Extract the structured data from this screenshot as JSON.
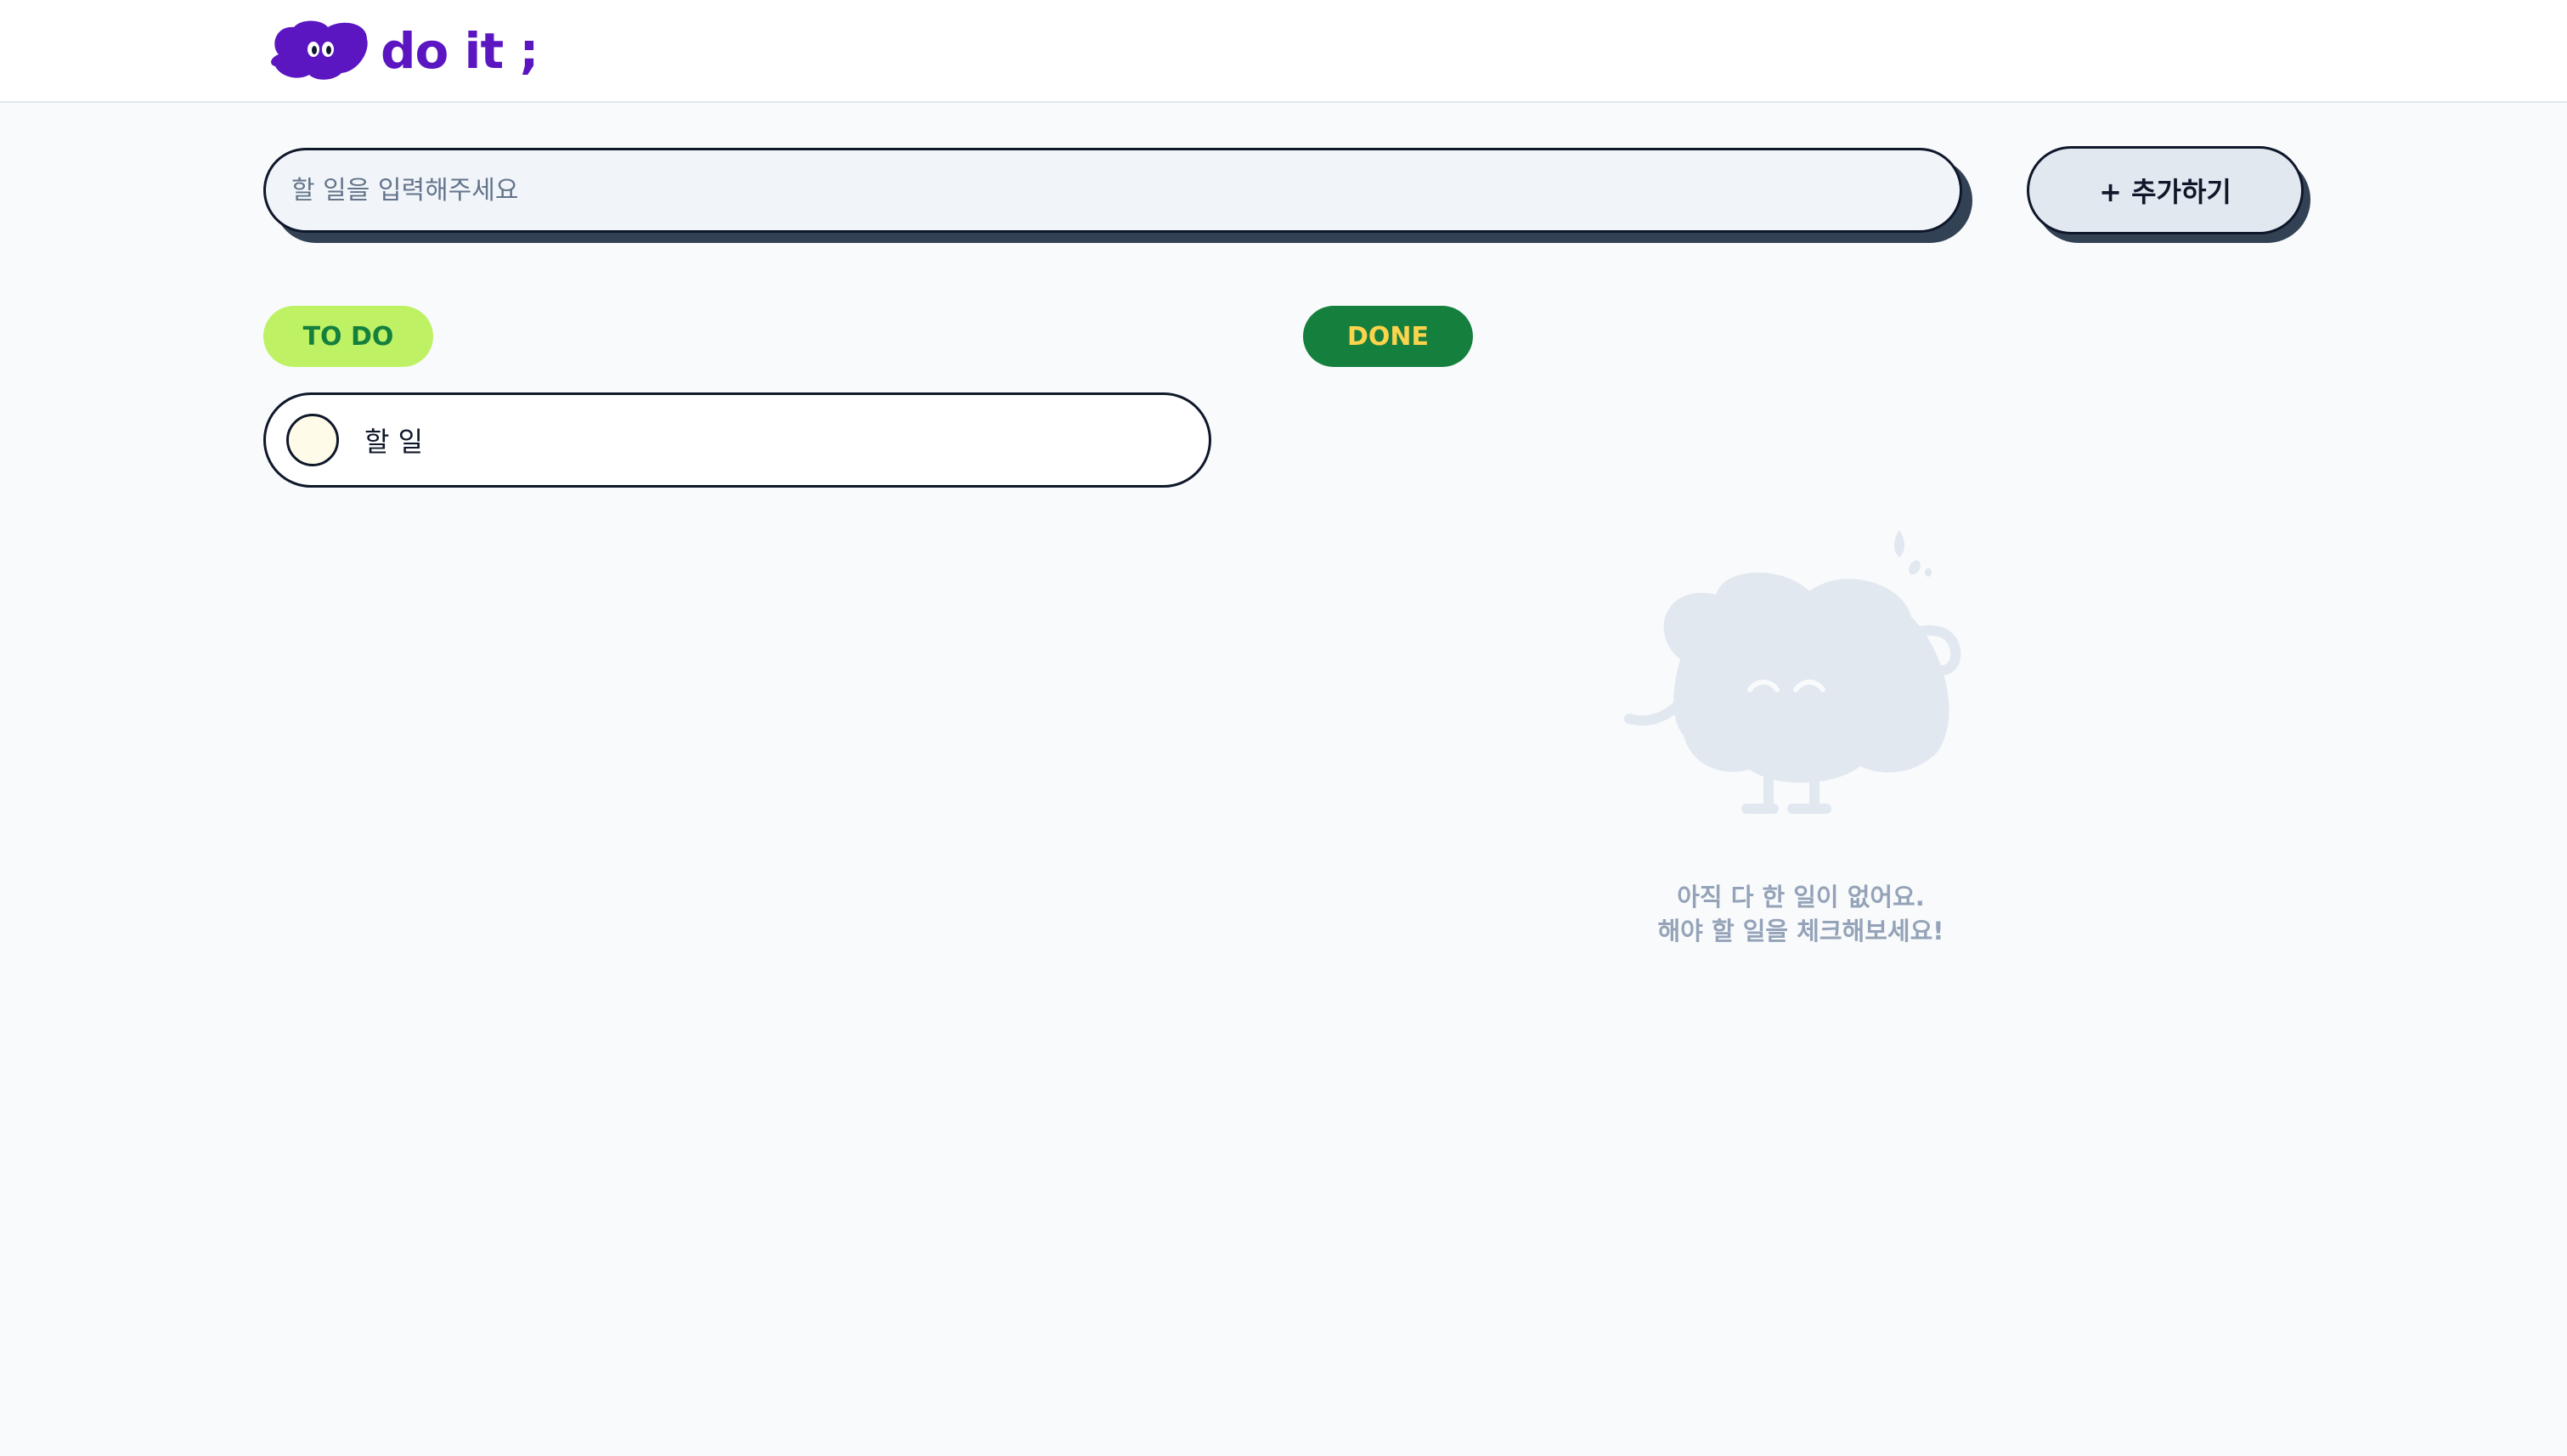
{
  "header": {
    "logo_text": "do it ;",
    "logo_icon": "cloud-mascot-icon",
    "brand_color": "#5b16c1"
  },
  "search": {
    "placeholder": "할 일을 입력해주세요",
    "value": ""
  },
  "add_button": {
    "label": "+ 추가하기"
  },
  "todo": {
    "section_label": "TO DO",
    "items": [
      {
        "label": "할 일",
        "done": false
      }
    ]
  },
  "done": {
    "section_label": "DONE",
    "empty_line1": "아직 다 한 일이 없어요.",
    "empty_line2": "해야 할 일을 체크해보세요!",
    "empty_icon": "empty-cloud-mascot-icon"
  },
  "colors": {
    "todo_pill_bg": "#bef264",
    "todo_pill_text": "#15803d",
    "done_pill_bg": "#15803d",
    "done_pill_text": "#fcd34d",
    "page_bg": "#f8fafc"
  }
}
